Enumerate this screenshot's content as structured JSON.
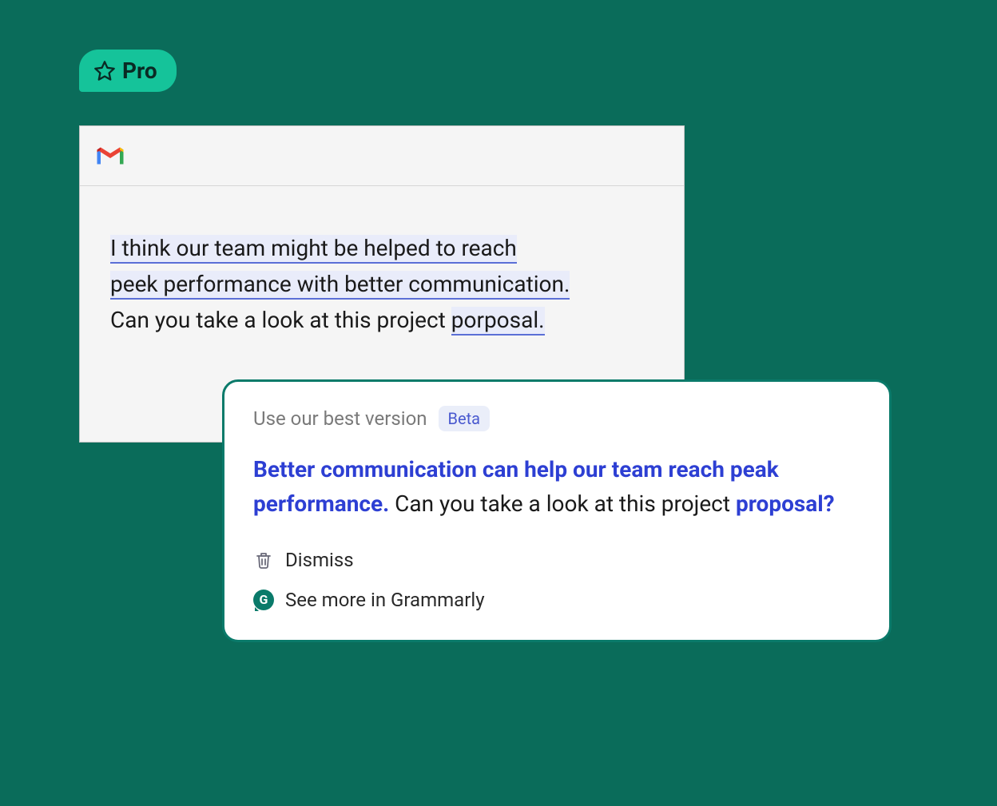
{
  "badge": {
    "label": "Pro"
  },
  "gmail": {
    "body": {
      "line1": "I think our team might be helped to reach",
      "line2": "peek performance with better communication.",
      "line3_prefix": "Can you take a look at this project ",
      "line3_highlight": "porposal."
    }
  },
  "card": {
    "header_title": "Use our best version",
    "beta_label": "Beta",
    "suggestion": {
      "bold1": "Better communication can help our team reach peak performance.",
      "plain": " Can you take a look at this project ",
      "bold2": "proposal?"
    },
    "actions": {
      "dismiss": "Dismiss",
      "see_more": "See more in Grammarly"
    }
  }
}
